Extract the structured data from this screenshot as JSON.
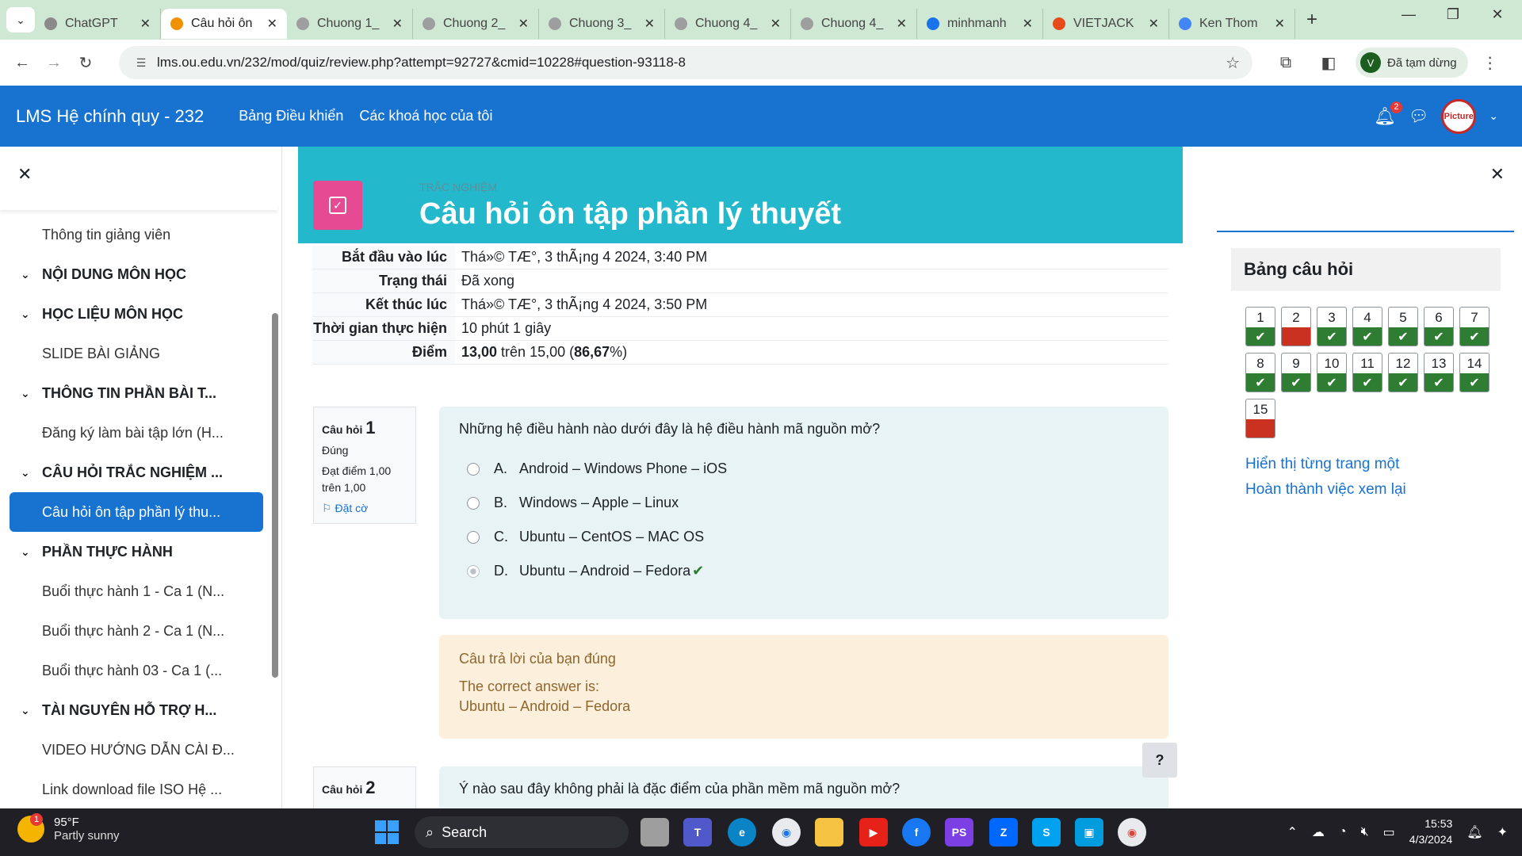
{
  "browser": {
    "tabs": [
      {
        "title": "ChatGPT",
        "fav_color": "#8a8a8a",
        "active": false
      },
      {
        "title": "Câu hỏi ôn",
        "fav_color": "#f29100",
        "active": true
      },
      {
        "title": "Chuong 1_",
        "fav_color": "#9e9e9e",
        "active": false
      },
      {
        "title": "Chuong 2_",
        "fav_color": "#9e9e9e",
        "active": false
      },
      {
        "title": "Chuong 3_",
        "fav_color": "#9e9e9e",
        "active": false
      },
      {
        "title": "Chuong 4_",
        "fav_color": "#9e9e9e",
        "active": false
      },
      {
        "title": "Chuong 4_",
        "fav_color": "#9e9e9e",
        "active": false
      },
      {
        "title": "minhmanh",
        "fav_color": "#1a73e8",
        "active": false
      },
      {
        "title": "VIETJACK",
        "fav_color": "#e64a19",
        "active": false
      },
      {
        "title": "Ken Thom",
        "fav_color": "#4285f4",
        "active": false
      }
    ],
    "url": "lms.ou.edu.vn/232/mod/quiz/review.php?attempt=92727&cmid=10228#question-93118-8",
    "profile_initial": "V",
    "profile_status": "Đã tạm dừng"
  },
  "lms": {
    "brand": "LMS Hệ chính quy - 232",
    "nav": [
      "Bảng Điều khiển",
      "Các khoá học của tôi"
    ],
    "notification_count": "2",
    "user_pic_text": "Picture"
  },
  "drawer": {
    "items": [
      {
        "label": "Thông tin giảng viên",
        "kind": "sub"
      },
      {
        "label": "NỘI DUNG MÔN HỌC",
        "kind": "sec"
      },
      {
        "label": "HỌC LIỆU MÔN HỌC",
        "kind": "sec"
      },
      {
        "label": "SLIDE BÀI GIẢNG",
        "kind": "sub"
      },
      {
        "label": "THÔNG TIN PHẦN BÀI T...",
        "kind": "sec"
      },
      {
        "label": "Đăng ký làm bài tập lớn (H...",
        "kind": "sub"
      },
      {
        "label": "CÂU HỎI TRẮC NGHIỆM ...",
        "kind": "sec"
      },
      {
        "label": "Câu hỏi ôn tập phần lý thu...",
        "kind": "active"
      },
      {
        "label": "PHẦN THỰC HÀNH",
        "kind": "sec"
      },
      {
        "label": "Buổi thực hành 1 - Ca 1 (N...",
        "kind": "sub"
      },
      {
        "label": "Buổi thực hành 2 - Ca 1 (N...",
        "kind": "sub"
      },
      {
        "label": "Buổi thực hành 03 - Ca 1 (...",
        "kind": "sub"
      },
      {
        "label": "TÀI NGUYÊN HỖ TRỢ H...",
        "kind": "sec"
      },
      {
        "label": "VIDEO HƯỚNG DẪN CÀI Đ...",
        "kind": "sub"
      },
      {
        "label": "Link download file ISO Hệ ...",
        "kind": "sub"
      }
    ]
  },
  "quiz": {
    "kicker": "TRẮC NGHIỆM",
    "title": "Câu hỏi ôn tập phần lý thuyết",
    "summary": {
      "started_label": "Bắt đầu vào lúc",
      "started_value": "Thá»© TÆ°, 3 thÃ¡ng 4 2024, 3:40 PM",
      "state_label": "Trạng thái",
      "state_value": "Đã xong",
      "completed_label": "Kết thúc lúc",
      "completed_value": "Thá»© TÆ°, 3 thÃ¡ng 4 2024, 3:50 PM",
      "duration_label": "Thời gian thực hiện",
      "duration_value": "10 phút 1 giây",
      "grade_label": "Điểm",
      "grade_score": "13,00",
      "grade_mid": " trên 15,00 (",
      "grade_pct": "86,67",
      "grade_end": "%)"
    },
    "q1": {
      "label": "Câu hỏi",
      "number": "1",
      "status": "Đúng",
      "mark": "Đạt điểm 1,00 trên 1,00",
      "flag": "Đặt cờ",
      "text": "Những hệ điều hành nào dưới đây là hệ điều hành mã nguồn mở?",
      "answers": [
        {
          "letter": "A.",
          "text": "Android – Windows Phone – iOS"
        },
        {
          "letter": "B.",
          "text": "Windows – Apple – Linux"
        },
        {
          "letter": "C.",
          "text": "Ubuntu – CentOS – MAC OS"
        },
        {
          "letter": "D.",
          "text": "Ubuntu – Android – Fedora"
        }
      ],
      "selected": "D.",
      "feedback": "Câu trả lời của bạn đúng",
      "correct_label": "The correct answer is:",
      "correct_answer": "Ubuntu – Android – Fedora"
    },
    "q2": {
      "label": "Câu hỏi",
      "number": "2",
      "text": "Ý nào sau đây không phải là đặc điểm của phần mềm mã nguồn mở?"
    },
    "help": "?"
  },
  "nav_block": {
    "title": "Bảng câu hỏi",
    "questions": [
      {
        "n": "1",
        "ok": true
      },
      {
        "n": "2",
        "ok": false
      },
      {
        "n": "3",
        "ok": true
      },
      {
        "n": "4",
        "ok": true
      },
      {
        "n": "5",
        "ok": true
      },
      {
        "n": "6",
        "ok": true
      },
      {
        "n": "7",
        "ok": true
      },
      {
        "n": "8",
        "ok": true
      },
      {
        "n": "9",
        "ok": true
      },
      {
        "n": "10",
        "ok": true
      },
      {
        "n": "11",
        "ok": true
      },
      {
        "n": "12",
        "ok": true
      },
      {
        "n": "13",
        "ok": true
      },
      {
        "n": "14",
        "ok": true
      },
      {
        "n": "15",
        "ok": false
      }
    ],
    "link_pages": "Hiển thị từng trang một",
    "link_finish": "Hoàn thành việc xem lại"
  },
  "taskbar": {
    "weather_badge": "1",
    "temp": "95°F",
    "condition": "Partly sunny",
    "search": "Search",
    "time": "15:53",
    "date": "4/3/2024"
  }
}
